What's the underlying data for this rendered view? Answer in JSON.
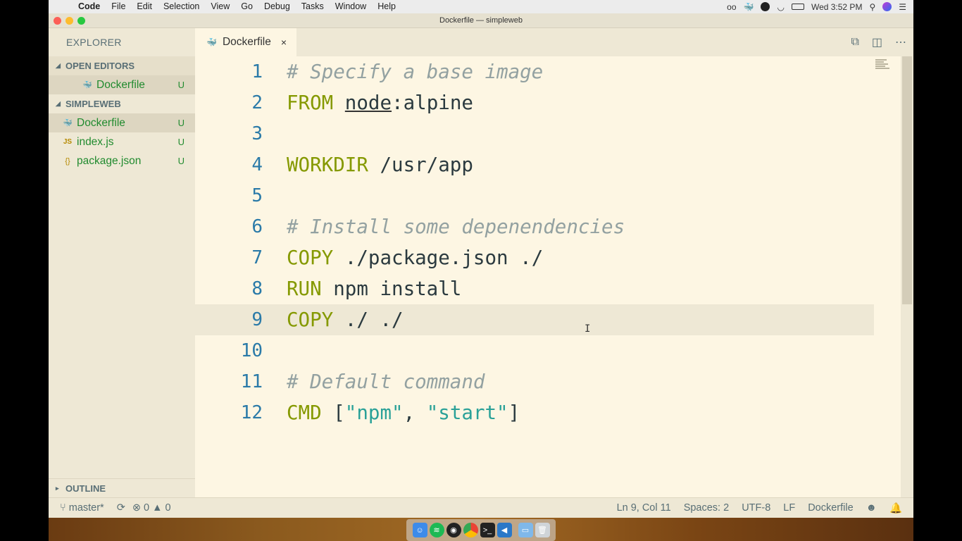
{
  "menubar": {
    "app": "Code",
    "items": [
      "File",
      "Edit",
      "Selection",
      "View",
      "Go",
      "Debug",
      "Tasks",
      "Window",
      "Help"
    ],
    "clock": "Wed 3:52 PM"
  },
  "window": {
    "title": "Dockerfile — simpleweb"
  },
  "sidebar": {
    "title": "EXPLORER",
    "open_editors_label": "OPEN EDITORS",
    "open_editors": [
      {
        "name": "Dockerfile",
        "badge": "U",
        "icon": "docker-whale-icon"
      }
    ],
    "project_label": "SIMPLEWEB",
    "files": [
      {
        "name": "Dockerfile",
        "badge": "U",
        "icon": "docker-whale-icon",
        "glyph": "🐳"
      },
      {
        "name": "index.js",
        "badge": "U",
        "icon": "js-file-icon",
        "glyph": "JS"
      },
      {
        "name": "package.json",
        "badge": "U",
        "icon": "json-file-icon",
        "glyph": "{}"
      }
    ],
    "outline_label": "OUTLINE"
  },
  "tabs": [
    {
      "label": "Dockerfile",
      "close": "×"
    }
  ],
  "code": {
    "lines": [
      "1",
      "2",
      "3",
      "4",
      "5",
      "6",
      "7",
      "8",
      "9",
      "10",
      "11",
      "12"
    ],
    "l1": "# Specify a base image",
    "l2_kw": "FROM",
    "l2_a": "node",
    "l2_b": ":alpine",
    "l4_kw": "WORKDIR",
    "l4_rest": " /usr/app",
    "l6": "# Install some depenendencies",
    "l7_kw": "COPY",
    "l7_rest": " ./package.json ./",
    "l8_kw": "RUN",
    "l8_rest": " npm install",
    "l9_kw": "COPY",
    "l9_rest": " ./ ./",
    "l11": "# Default command",
    "l12_kw": "CMD",
    "l12_a": " [",
    "l12_s1": "\"npm\"",
    "l12_b": ", ",
    "l12_s2": "\"start\"",
    "l12_c": "]"
  },
  "statusbar": {
    "branch": "master*",
    "errors": "0",
    "warnings": "0",
    "position": "Ln 9, Col 11",
    "spaces": "Spaces: 2",
    "encoding": "UTF-8",
    "eol": "LF",
    "language": "Dockerfile"
  },
  "colors": {
    "background": "#fdf6e3",
    "sidebar": "#eee8d5",
    "keyword": "#859900",
    "comment": "#93a1a1",
    "string": "#2aa198",
    "line_number": "#2a7aa8",
    "untracked": "#218b2f"
  }
}
